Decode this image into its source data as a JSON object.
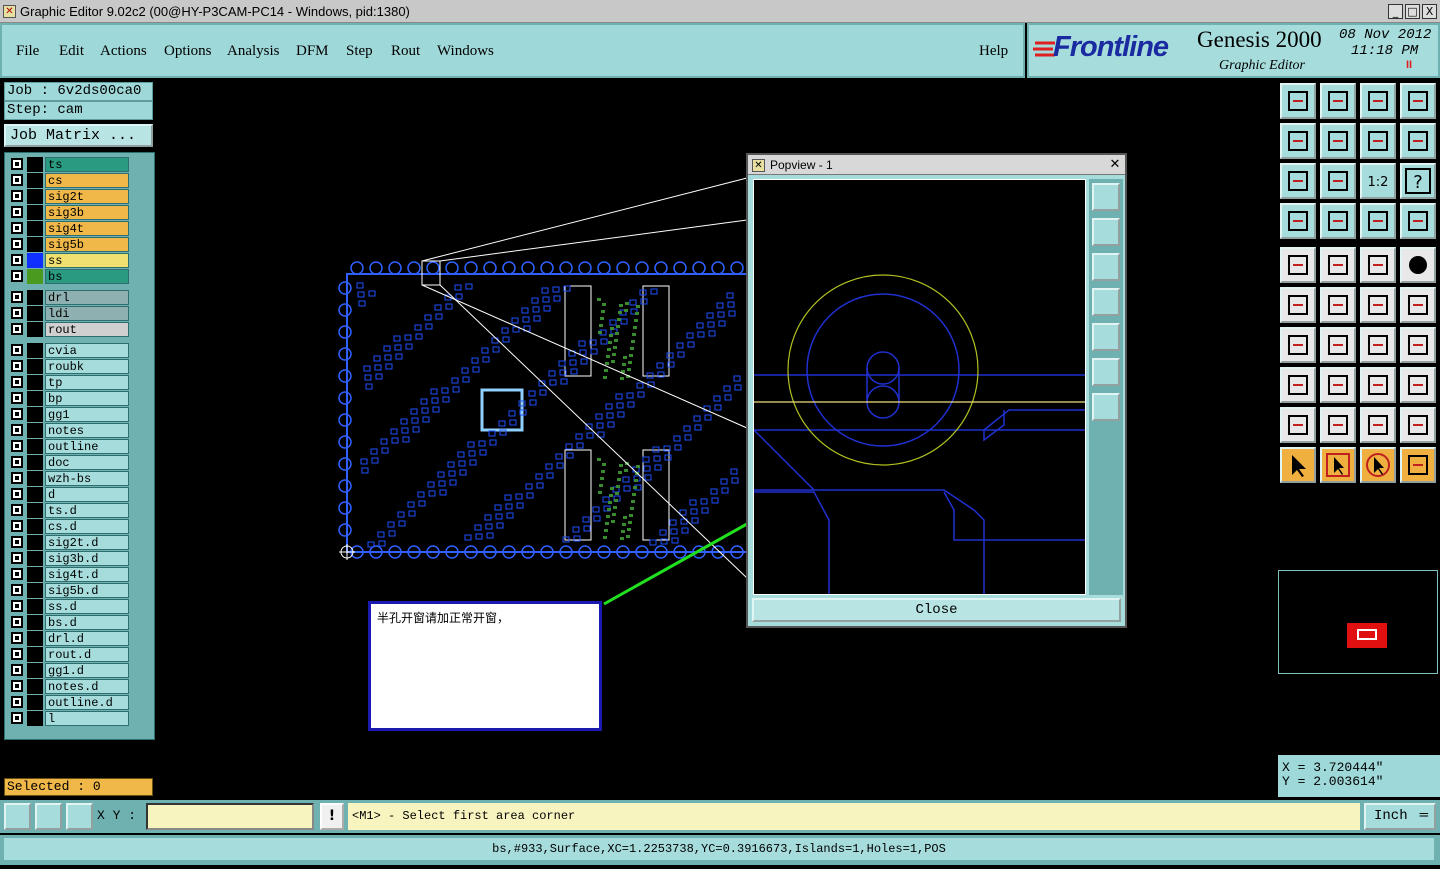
{
  "window": {
    "title": "Graphic Editor 9.02c2 (00@HY-P3CAM-PC14 - Windows, pid:1380)",
    "controls": [
      "_",
      "□",
      "X"
    ]
  },
  "menu": {
    "items": [
      "File",
      "Edit",
      "Actions",
      "Options",
      "Analysis",
      "DFM",
      "Step",
      "Rout",
      "Windows"
    ],
    "help": "Help"
  },
  "brand": {
    "logo": "Frontline",
    "product": "Genesis 2000",
    "subtitle": "Graphic Editor",
    "date": "08 Nov 2012",
    "time": "11:18 PM",
    "pause": "II"
  },
  "job": {
    "job_line": "Job : 6v2ds00ca0",
    "step_line": "Step: cam",
    "matrix_button": "Job Matrix ..."
  },
  "layers": {
    "group1": [
      {
        "name": "ts",
        "color": "#2a9a80",
        "swatch": "#000000"
      },
      {
        "name": "cs",
        "color": "#f0b848",
        "swatch": "#000000"
      },
      {
        "name": "sig2t",
        "color": "#f0b848",
        "swatch": "#000000"
      },
      {
        "name": "sig3b",
        "color": "#f0b848",
        "swatch": "#000000"
      },
      {
        "name": "sig4t",
        "color": "#f0b848",
        "swatch": "#000000"
      },
      {
        "name": "sig5b",
        "color": "#f0b848",
        "swatch": "#000000"
      },
      {
        "name": "ss",
        "color": "#f0e070",
        "swatch": "#1030ff"
      },
      {
        "name": "bs",
        "color": "#2a9a80",
        "swatch": "#4a9a20"
      }
    ],
    "group2": [
      {
        "name": "drl",
        "color": "#8eb0b0"
      },
      {
        "name": "ldi",
        "color": "#8eb0b0"
      },
      {
        "name": "rout",
        "color": "#d0d0d0"
      }
    ],
    "group3": [
      "cvia",
      "roubk",
      "tp",
      "bp",
      "gg1",
      "notes",
      "outline",
      "doc",
      "wzh-bs",
      "d",
      "ts.d",
      "cs.d",
      "sig2t.d",
      "sig3b.d",
      "sig4t.d",
      "sig5b.d",
      "ss.d",
      "bs.d",
      "drl.d",
      "rout.d",
      "gg1.d",
      "notes.d",
      "outline.d",
      "l"
    ]
  },
  "selected": "Selected : 0",
  "coords": {
    "x": "X = 3.720444\"",
    "y": "Y = 2.003614\""
  },
  "command": {
    "xy_label": "X Y :",
    "xy_value": "",
    "prompt": "<M1> - Select first area corner",
    "units": "Inch"
  },
  "status": "bs,#933,Surface,XC=1.2253738,YC=0.3916673,Islands=1,Holes=1,POS",
  "popview": {
    "title": "Popview - 1",
    "close": "Close"
  },
  "note": {
    "text": "半孔开窗请加正常开窗，"
  },
  "toolbar_icons": [
    "zoom-home-icon",
    "zoom-reset-icon",
    "home-view-icon",
    "window-view-icon",
    "pan-left-icon",
    "pan-right-icon",
    "undo-view-icon",
    "snap-icon",
    "fit-height-icon",
    "fit-all-icon",
    "scale-1-2-icon",
    "help-icon",
    "measure-profile-icon",
    "pad-line-icon",
    "netlist-icon",
    "netlist-red-icon",
    "pad-select-icon",
    "slash-select-icon",
    "ruler-icon",
    "dot-icon",
    "connect-icon",
    "cross-icon",
    "move-icon",
    "drag-icon",
    "angle-icon",
    "line-icon",
    "arc-icon",
    "mirror-icon",
    "copy-icon",
    "split-icon",
    "align-icon",
    "group-icon",
    "triangle-icon",
    "triangle-up-icon",
    "triangle-a-icon",
    "triangle-b-icon",
    "pointer-icon",
    "pointer-box-icon",
    "pointer-circle-icon",
    "route-icon"
  ]
}
